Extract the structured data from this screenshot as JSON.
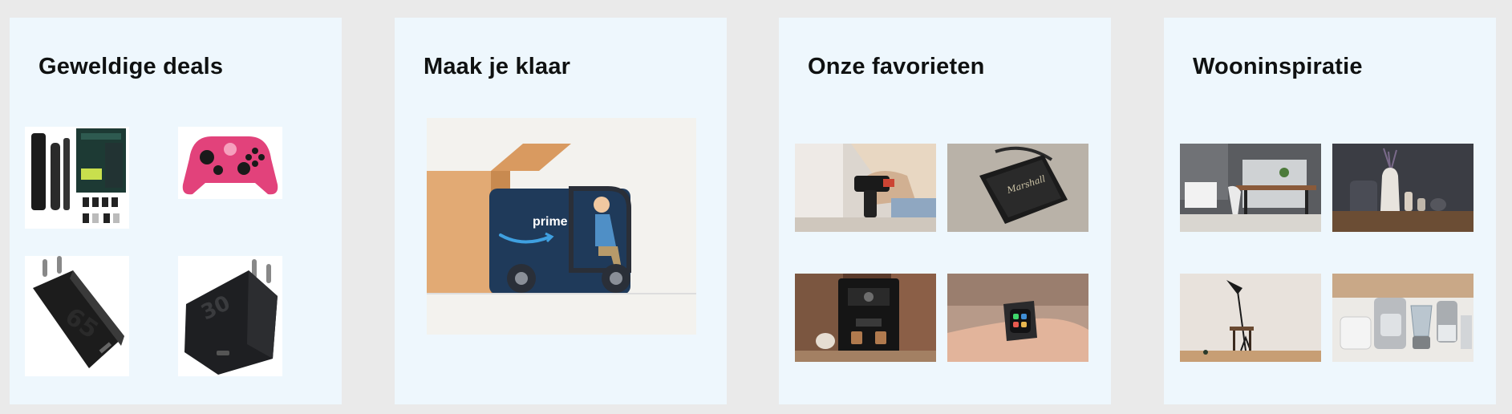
{
  "cards": [
    {
      "title": "Geweldige deals",
      "items": [
        {
          "icon": "grooming-kit-icon"
        },
        {
          "icon": "pink-game-controller-icon"
        },
        {
          "icon": "usb-charger-icon"
        },
        {
          "icon": "compact-charger-icon"
        }
      ]
    },
    {
      "title": "Maak je klaar",
      "items": [
        {
          "icon": "prime-delivery-illustration-icon",
          "label": "prime"
        }
      ]
    },
    {
      "title": "Onze favorieten",
      "items": [
        {
          "icon": "power-drill-photo-icon"
        },
        {
          "icon": "marshall-speaker-photo-icon",
          "label": "Marshall"
        },
        {
          "icon": "espresso-machine-photo-icon"
        },
        {
          "icon": "smartwatch-photo-icon"
        }
      ]
    },
    {
      "title": "Wooninspiratie",
      "items": [
        {
          "icon": "dining-room-photo-icon"
        },
        {
          "icon": "vases-shelf-photo-icon"
        },
        {
          "icon": "floor-lamp-photo-icon"
        },
        {
          "icon": "kitchen-appliances-photo-icon"
        }
      ]
    }
  ],
  "colors": {
    "page_background": "#eaeaea",
    "card_background": "#eef7fd",
    "title_text": "#0f1111",
    "prime_blue": "#1f3a5a",
    "controller_pink": "#e2427b"
  }
}
